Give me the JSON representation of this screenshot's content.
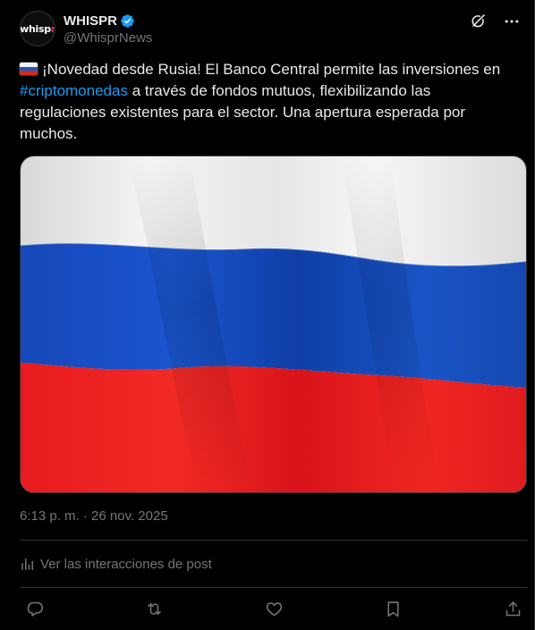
{
  "author": {
    "display_name": "WHISPR",
    "handle": "@WhisprNews",
    "verified": true,
    "avatar_text": "whisp",
    "avatar_accent": "r"
  },
  "header_actions": {
    "grok_icon": "grok-icon",
    "more_icon": "more-options-icon"
  },
  "post": {
    "emoji": "russia-flag-emoji",
    "text_before": "¡Novedad desde Rusia! El Banco Central permite las inversiones en ",
    "hashtag": "#criptomonedas",
    "text_after": " a través de fondos mutuos, flexibilizando las regulaciones existentes para el sector. Una apertura esperada por muchos.",
    "media_alt": "Russian flag waving",
    "timestamp": "6:13 p. m. · 26 nov. 2025"
  },
  "analytics": {
    "label": "Ver las interacciones de post"
  },
  "actions": {
    "reply_icon": "reply-icon",
    "repost_icon": "repost-icon",
    "like_icon": "like-icon",
    "bookmark_icon": "bookmark-icon",
    "share_icon": "share-icon"
  },
  "colors": {
    "background": "#000000",
    "text": "#e7e9ea",
    "secondary": "#71767b",
    "accent": "#1d9bf0",
    "divider": "#2f3336",
    "flag_white": "#f2f2f2",
    "flag_blue": "#0b3fb0",
    "flag_red": "#e4141b"
  }
}
